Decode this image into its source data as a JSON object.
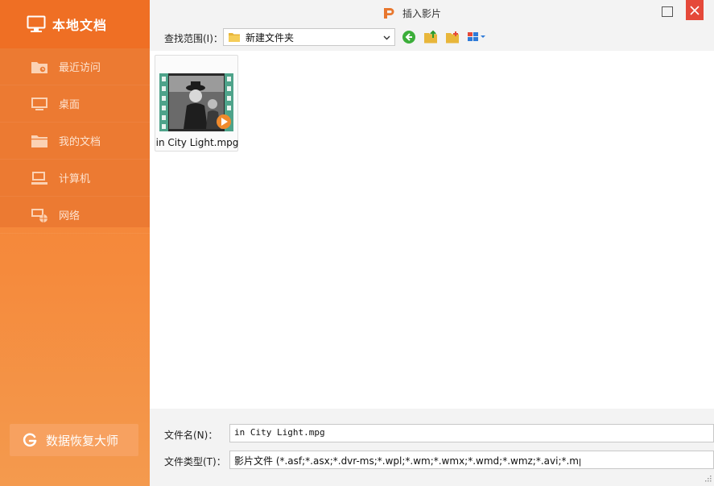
{
  "sidebar": {
    "title": "本地文档",
    "items": [
      {
        "label": "最近访问",
        "icon": "recent-folder-icon"
      },
      {
        "label": "桌面",
        "icon": "desktop-icon"
      },
      {
        "label": "我的文档",
        "icon": "folder-icon"
      },
      {
        "label": "计算机",
        "icon": "computer-icon"
      },
      {
        "label": "网络",
        "icon": "network-icon"
      }
    ],
    "recover_label": "数据恢复大师"
  },
  "window": {
    "title": "插入影片"
  },
  "toolbar": {
    "lookin_label": "查找范围(I)：",
    "lookin_value": "新建文件夹"
  },
  "files": [
    {
      "name": "in City Light.mpg",
      "icon": "video-thumbnail"
    }
  ],
  "bottom": {
    "filename_label": "文件名(N)：",
    "filename_value": "in City Light.mpg",
    "filetype_label": "文件类型(T)：",
    "filetype_value": "影片文件 (*.asf;*.asx;*.dvr-ms;*.wpl;*.wm;*.wmx;*.wmd;*.wmz;*.avi;*.mpeg;*.mpg"
  },
  "colors": {
    "sidebar_orange": "#f47f34",
    "close_red": "#e5493a",
    "back_green": "#3cae3a"
  }
}
